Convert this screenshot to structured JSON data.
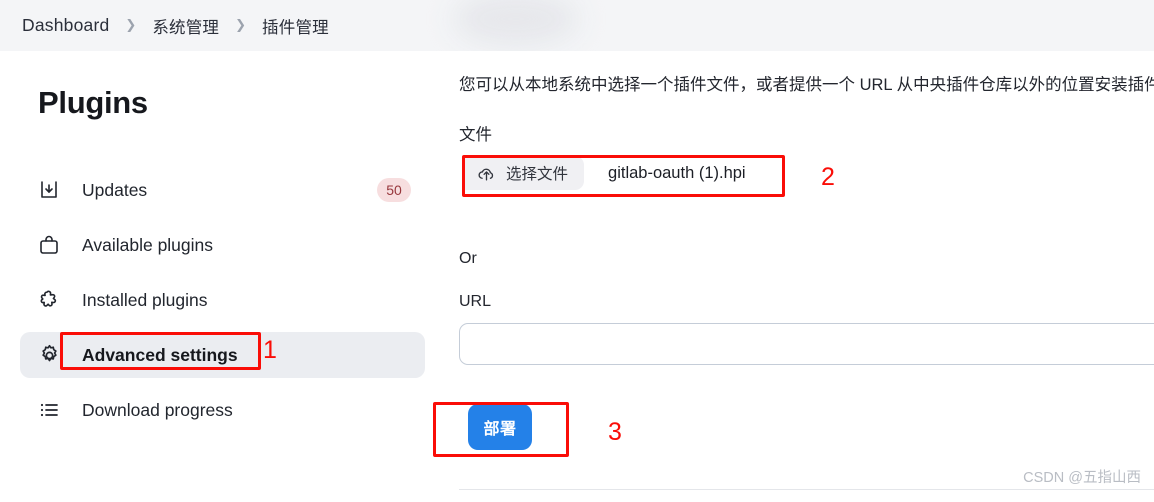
{
  "breadcrumb": {
    "items": [
      {
        "label": "Dashboard"
      },
      {
        "label": "系统管理"
      },
      {
        "label": "插件管理"
      }
    ],
    "separator": "❯"
  },
  "sidebar": {
    "title": "Plugins",
    "items": [
      {
        "label": "Updates",
        "icon": "download-box-icon",
        "badge": "50",
        "active": false
      },
      {
        "label": "Available plugins",
        "icon": "shopping-bag-icon",
        "badge": "",
        "active": false
      },
      {
        "label": "Installed plugins",
        "icon": "puzzle-piece-icon",
        "badge": "",
        "active": false
      },
      {
        "label": "Advanced settings",
        "icon": "gear-icon",
        "badge": "",
        "active": true
      },
      {
        "label": "Download progress",
        "icon": "list-icon",
        "badge": "",
        "active": false
      }
    ]
  },
  "main": {
    "description": "您可以从本地系统中选择一个插件文件，或者提供一个 URL 从中央插件仓库以外的位置安装插件。",
    "file_label": "文件",
    "file_button_label": "选择文件",
    "file_button_icon": "cloud-upload-icon",
    "file_name": "gitlab-oauth (1).hpi",
    "or_label": "Or",
    "url_label": "URL",
    "url_value": "",
    "url_placeholder": "",
    "deploy_label": "部署"
  },
  "annotations": [
    {
      "number": "1"
    },
    {
      "number": "2"
    },
    {
      "number": "3"
    }
  ],
  "watermark": "CSDN @五指山西",
  "colors": {
    "header_bg": "#f4f5f7",
    "active_item_bg": "#ebedf1",
    "badge_bg": "#f7dedf",
    "badge_text": "#98373c",
    "deploy_bg": "#2481e8",
    "annotation_red": "#fa0d07"
  }
}
